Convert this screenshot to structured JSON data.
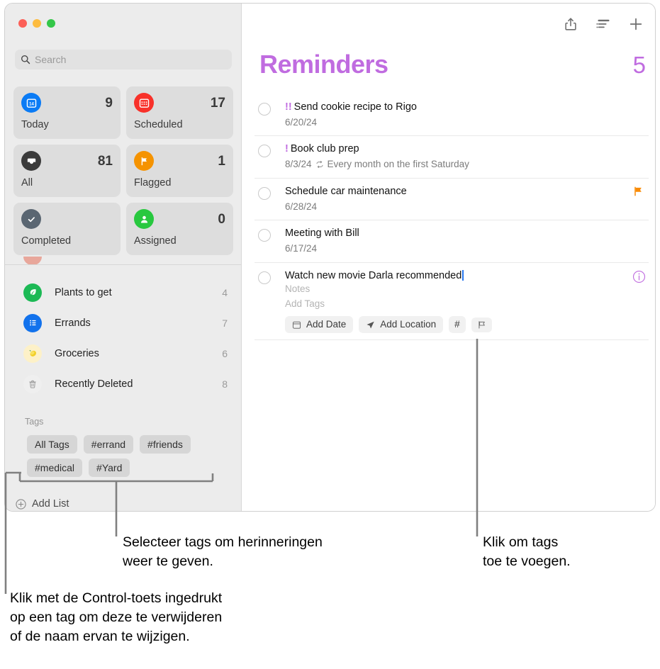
{
  "window": {
    "traffic_lights": [
      "close",
      "minimize",
      "zoom"
    ]
  },
  "sidebar": {
    "search": {
      "placeholder": "Search",
      "value": "",
      "icon": "search-icon"
    },
    "smart_cards": [
      {
        "label": "Today",
        "count": "9",
        "icon": "calendar-icon",
        "color": "#0a7bf5"
      },
      {
        "label": "Scheduled",
        "count": "17",
        "icon": "calendar-days-icon",
        "color": "#f8312a"
      },
      {
        "label": "All",
        "count": "81",
        "icon": "inbox-tray-icon",
        "color": "#3b3b3b"
      },
      {
        "label": "Flagged",
        "count": "1",
        "icon": "flag-icon",
        "color": "#f59300"
      },
      {
        "label": "Completed",
        "count": "",
        "icon": "checkmark-icon",
        "color": "#5a6672"
      },
      {
        "label": "Assigned",
        "count": "0",
        "icon": "person-icon",
        "color": "#28c83f"
      }
    ],
    "lists": [
      {
        "name": "Plants to get",
        "count": "4",
        "icon": "leaf-icon",
        "color": "#1cb955"
      },
      {
        "name": "Errands",
        "count": "7",
        "icon": "bullet-list-icon",
        "color": "#1272ec"
      },
      {
        "name": "Groceries",
        "count": "6",
        "icon": "lemon-icon",
        "color": "#fdf1c8"
      },
      {
        "name": "Recently Deleted",
        "count": "8",
        "icon": "trash-icon",
        "color": "#f0f0f0"
      }
    ],
    "tags_header": "Tags",
    "tags": [
      "All Tags",
      "#errand",
      "#friends",
      "#medical",
      "#Yard"
    ],
    "add_list": {
      "label": "Add List",
      "icon": "plus-circle-icon"
    }
  },
  "main": {
    "toolbar": [
      {
        "name": "share-icon",
        "label": "Share"
      },
      {
        "name": "list-view-icon",
        "label": "View options"
      },
      {
        "name": "plus-icon",
        "label": "New reminder"
      }
    ],
    "title": "Reminders",
    "count": "5",
    "accent_color": "#c06ce0",
    "reminders": [
      {
        "priority": "!!",
        "title": "Send cookie recipe to Rigo",
        "date": "6/20/24",
        "repeat": "",
        "flagged": false,
        "selected": false
      },
      {
        "priority": "!",
        "title": "Book club prep",
        "date": "8/3/24",
        "repeat": "Every month on the first Saturday",
        "flagged": false,
        "selected": false
      },
      {
        "priority": "",
        "title": "Schedule car maintenance",
        "date": "6/28/24",
        "repeat": "",
        "flagged": true,
        "selected": false
      },
      {
        "priority": "",
        "title": "Meeting with Bill",
        "date": "6/17/24",
        "repeat": "",
        "flagged": false,
        "selected": false
      },
      {
        "priority": "",
        "title": "Watch new movie Darla recommended",
        "date": "",
        "repeat": "",
        "flagged": false,
        "selected": true,
        "notes_placeholder": "Notes",
        "tags_placeholder": "Add Tags",
        "chips": [
          {
            "label": "Add Date",
            "icon": "calendar-chip-icon"
          },
          {
            "label": "Add Location",
            "icon": "location-arrow-icon"
          },
          {
            "label": "#",
            "icon": "hash-icon"
          },
          {
            "label": "",
            "icon": "flag-outline-icon"
          }
        ]
      }
    ]
  },
  "callouts": {
    "tags_display": "Selecteer tags om herinneringen\nweer te geven.",
    "tags_add": "Klik om tags\ntoe te voegen.",
    "tags_control_click": "Klik met de Control-toets ingedrukt\nop een tag om deze te verwijderen\nof de naam ervan te wijzigen."
  }
}
